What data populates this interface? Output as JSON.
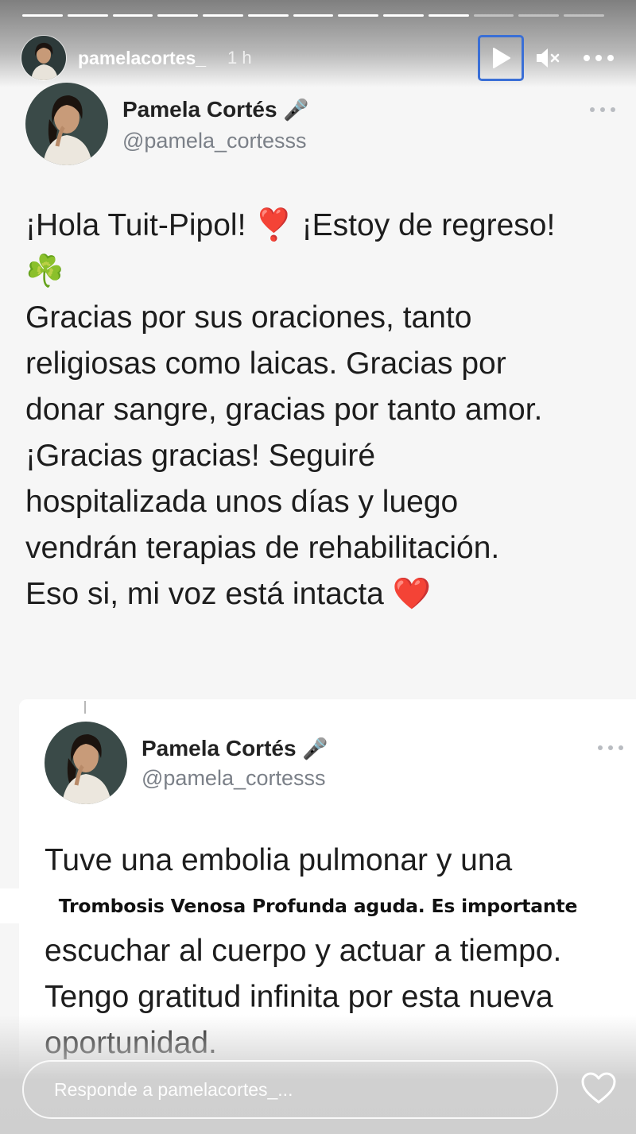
{
  "story": {
    "progress_total": 13,
    "progress_done": 10,
    "username": "pamelacortes_",
    "time_ago": "1 h"
  },
  "tweet1": {
    "name": "Pamela Cortés",
    "name_emoji": "🎤",
    "handle": "@pamela_cortesss",
    "lines": [
      "¡Hola Tuit-Pipol! ❣️ ¡Estoy de regreso!",
      "☘️",
      "Gracias por sus oraciones, tanto",
      "religiosas como laicas. Gracias por",
      "donar sangre, gracias por tanto amor.",
      "¡Gracias gracias! Seguiré",
      "hospitalizada unos días y luego",
      "vendrán terapias de rehabilitación.",
      "Eso si, mi voz está intacta ❤️"
    ]
  },
  "tweet2": {
    "name": "Pamela Cortés",
    "name_emoji": "🎤",
    "handle": "@pamela_cortesss",
    "line1": "Tuve una embolia pulmonar y una",
    "overlay": "Trombosis Venosa Profunda aguda. Es importante",
    "lines_after": [
      "escuchar al cuerpo y actuar a tiempo.",
      "Tengo gratitud infinita por esta nueva",
      "oportunidad."
    ]
  },
  "reply": {
    "placeholder": "Responde a pamelacortes_..."
  },
  "icons": {
    "play": "play-icon",
    "mute": "speaker-muted-icon",
    "more": "more-horizontal-icon",
    "heart": "heart-outline-icon",
    "mic": "microphone-emoji",
    "clover": "shamrock-emoji"
  },
  "colors": {
    "play_focus_border": "#3a6fd6",
    "handle_gray": "#7b8088",
    "background": "#f6f6f6"
  }
}
